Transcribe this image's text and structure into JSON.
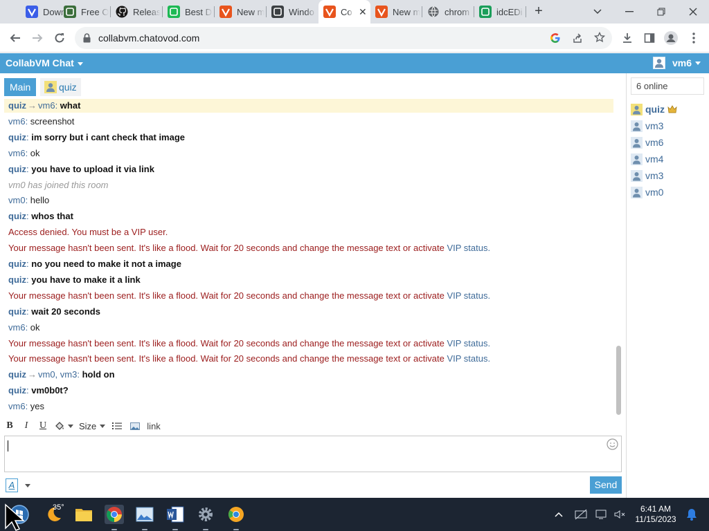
{
  "browser": {
    "tabs": [
      {
        "title": "Downl",
        "icon": "vivaldi-icon",
        "color": "#3b5ee8"
      },
      {
        "title": "Free O",
        "icon": "app-icon",
        "color": "#3b6e3b"
      },
      {
        "title": "Releas",
        "icon": "github-icon",
        "color": "#181717"
      },
      {
        "title": "Best D",
        "icon": "app-icon",
        "color": "#1db954"
      },
      {
        "title": "New m",
        "icon": "vivaldi-icon",
        "color": "#e8541d"
      },
      {
        "title": "Windo",
        "icon": "app-icon",
        "color": "#3c4043"
      },
      {
        "title": "Co",
        "icon": "vivaldi-icon",
        "color": "#e8541d",
        "active": true
      },
      {
        "title": "New m",
        "icon": "vivaldi-icon",
        "color": "#e8541d"
      },
      {
        "title": "chrom",
        "icon": "globe-icon",
        "color": "#5f6368"
      },
      {
        "title": "idcEDi",
        "icon": "app-icon",
        "color": "#1b9e5a"
      }
    ],
    "url": "collabvm.chatovod.com"
  },
  "chat": {
    "title": "CollabVM Chat",
    "current_user": "vm6",
    "rooms": [
      "Main",
      "quiz"
    ],
    "online_count": "6 online",
    "users": [
      {
        "name": "quiz",
        "bold": true,
        "crown": true
      },
      {
        "name": "vm3"
      },
      {
        "name": "vm6"
      },
      {
        "name": "vm4"
      },
      {
        "name": "vm3"
      },
      {
        "name": "vm0"
      }
    ],
    "messages": [
      {
        "type": "private",
        "from": "quiz",
        "to": "vm6",
        "text": "what",
        "highlight": true
      },
      {
        "type": "msg",
        "from": "vm6",
        "text": "screenshot"
      },
      {
        "type": "msg",
        "from": "quiz",
        "text": "im sorry but i cant check that image"
      },
      {
        "type": "msg",
        "from": "vm6",
        "text": "ok"
      },
      {
        "type": "msg",
        "from": "quiz",
        "text": "you have to upload it via link"
      },
      {
        "type": "system",
        "text": "vm0 has joined this room"
      },
      {
        "type": "msg",
        "from": "vm0",
        "text": "hello"
      },
      {
        "type": "msg",
        "from": "quiz",
        "text": "whos that"
      },
      {
        "type": "error",
        "text": "Access denied. You must be a VIP user."
      },
      {
        "type": "error",
        "text": "Your message hasn't been sent. It's like a flood. Wait for 20 seconds and change the message text or activate ",
        "link": "VIP status",
        "tail": "."
      },
      {
        "type": "msg",
        "from": "quiz",
        "text": "no you need to make it not a image"
      },
      {
        "type": "msg",
        "from": "quiz",
        "text": "you have to make it a link"
      },
      {
        "type": "error",
        "text": "Your message hasn't been sent. It's like a flood. Wait for 20 seconds and change the message text or activate ",
        "link": "VIP status",
        "tail": "."
      },
      {
        "type": "msg",
        "from": "quiz",
        "text": "wait 20 seconds"
      },
      {
        "type": "msg",
        "from": "vm6",
        "text": "ok"
      },
      {
        "type": "error",
        "text": "Your message hasn't been sent. It's like a flood. Wait for 20 seconds and change the message text or activate ",
        "link": "VIP status",
        "tail": "."
      },
      {
        "type": "error",
        "text": "Your message hasn't been sent. It's like a flood. Wait for 20 seconds and change the message text or activate ",
        "link": "VIP status",
        "tail": "."
      },
      {
        "type": "private",
        "from": "quiz",
        "to": "vm0, vm3",
        "text": "hold on"
      },
      {
        "type": "msg",
        "from": "quiz",
        "text": "vm0b0t?"
      },
      {
        "type": "msg",
        "from": "vm6",
        "text": "yes"
      }
    ],
    "editor": {
      "bold": "B",
      "italic": "I",
      "underline": "U",
      "size_label": "Size",
      "link_label": "link",
      "input_value": "",
      "font_color_label": "A",
      "send_label": "Send"
    }
  },
  "taskbar": {
    "weather_temp": "35°",
    "time": "6:41 AM",
    "date": "11/15/2023"
  },
  "colors": {
    "accent": "#4a9fd4",
    "username": "#3f6b99",
    "error": "#9b1c1c",
    "highlight": "#fdf6d7"
  }
}
